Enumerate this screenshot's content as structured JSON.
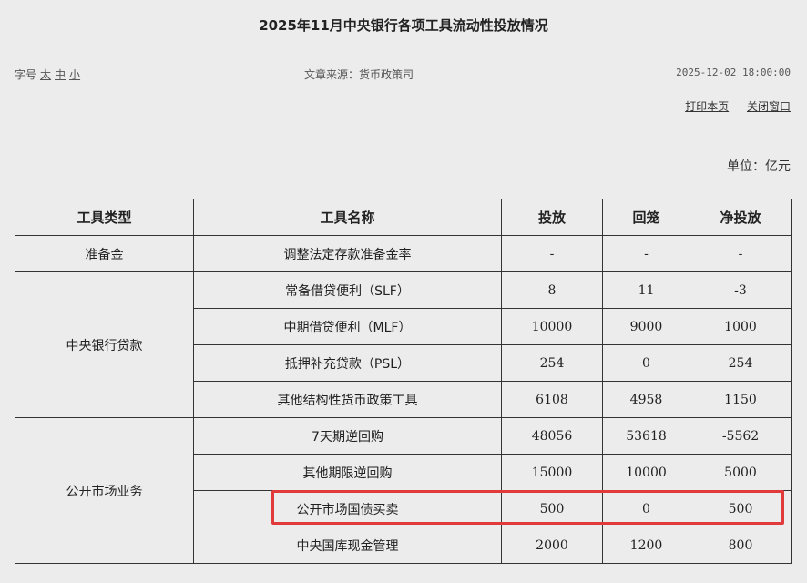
{
  "title": "2025年11月中央银行各项工具流动性投放情况",
  "meta": {
    "font_size_label": "字号",
    "font_sizes": [
      "太",
      "中",
      "小"
    ],
    "source": "文章来源：货币政策司",
    "datetime": "2025-12-02 18:00:00"
  },
  "links": {
    "print": "打印本页",
    "close": "关闭窗口"
  },
  "unit": "单位：亿元",
  "table": {
    "headers": [
      "工具类型",
      "工具名称",
      "投放",
      "回笼",
      "净投放"
    ],
    "groups": [
      {
        "type": "准备金",
        "rows": [
          {
            "name": "调整法定存款准备金率",
            "inject": "-",
            "withdraw": "-",
            "net": "-"
          }
        ]
      },
      {
        "type": "中央银行贷款",
        "rows": [
          {
            "name": "常备借贷便利（SLF）",
            "inject": "8",
            "withdraw": "11",
            "net": "-3"
          },
          {
            "name": "中期借贷便利（MLF）",
            "inject": "10000",
            "withdraw": "9000",
            "net": "1000"
          },
          {
            "name": "抵押补充贷款（PSL）",
            "inject": "254",
            "withdraw": "0",
            "net": "254"
          },
          {
            "name": "其他结构性货币政策工具",
            "inject": "6108",
            "withdraw": "4958",
            "net": "1150"
          }
        ]
      },
      {
        "type": "公开市场业务",
        "rows": [
          {
            "name": "7天期逆回购",
            "inject": "48056",
            "withdraw": "53618",
            "net": "-5562"
          },
          {
            "name": "其他期限逆回购",
            "inject": "15000",
            "withdraw": "10000",
            "net": "5000"
          },
          {
            "name": "公开市场国债买卖",
            "inject": "500",
            "withdraw": "0",
            "net": "500"
          },
          {
            "name": "中央国库现金管理",
            "inject": "2000",
            "withdraw": "1200",
            "net": "800"
          }
        ]
      }
    ]
  },
  "highlight_color": "#e03a3a"
}
